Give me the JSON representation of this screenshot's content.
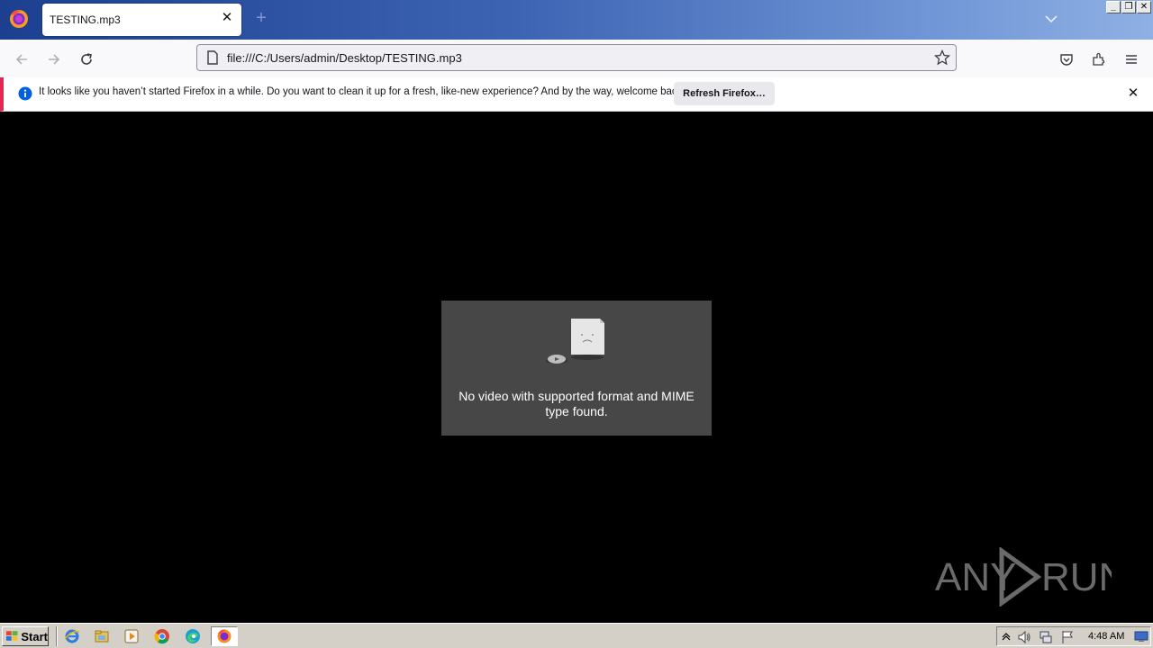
{
  "browser": {
    "tab": {
      "title": "TESTING.mp3"
    },
    "url": "file:///C:/Users/admin/Desktop/TESTING.mp3"
  },
  "notification": {
    "message": "It looks like you haven’t started Firefox in a while. Do you want to clean it up for a fresh, like-new experience? And by the way, welcome back!",
    "button_label": "Refresh Firefox…"
  },
  "media_error": {
    "message": "No video with supported format and MIME type found."
  },
  "watermark": {
    "text_left": "ANY",
    "text_right": "RUN"
  },
  "taskbar": {
    "start_label": "Start",
    "pinned": [
      "internet-explorer-icon",
      "file-explorer-icon",
      "media-player-icon",
      "chrome-icon",
      "edge-icon",
      "firefox-icon"
    ],
    "clock": "4:48 AM"
  },
  "colors": {
    "titlebar_gradient_start": "#1c3f8f",
    "notification_accent": "#e22850",
    "info_icon": "#0060df",
    "error_box": "#474747"
  }
}
